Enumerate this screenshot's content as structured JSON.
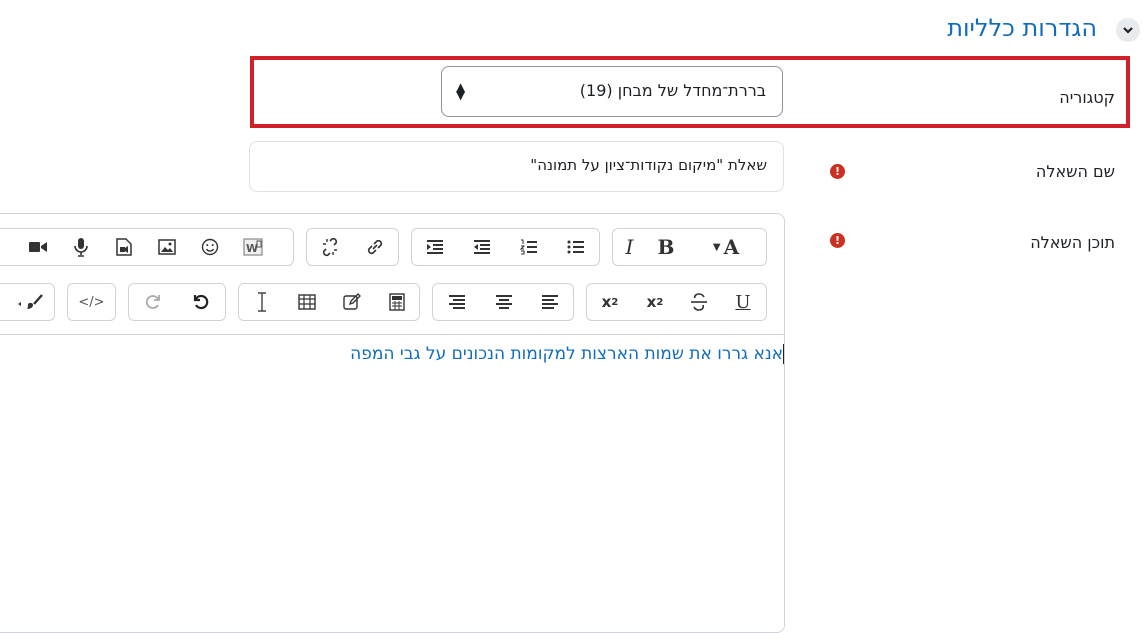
{
  "section": {
    "title": "הגדרות כלליות"
  },
  "category": {
    "label": "קטגוריה",
    "value": "בררת־מחדל של מבחן (19)"
  },
  "question_name": {
    "label": "שם השאלה",
    "value": "שאלת \"מיקום נקודות־ציון על תמונה\""
  },
  "question_text": {
    "label": "תוכן השאלה",
    "content": "אנא גררו את שמות הארצות למקומות הנכונים על גבי המפה"
  },
  "toolbar": {
    "row1": {
      "font_color": "A",
      "bold": "B",
      "italic": "I"
    },
    "row2": {
      "underline": "U",
      "superscript_base": "x",
      "superscript_exp": "2",
      "subscript_base": "x",
      "subscript_exp": "2",
      "html_code": "</>"
    }
  },
  "colors": {
    "accent": "#0f6cbf",
    "required": "#ca3120",
    "highlight": "#d0202a"
  }
}
